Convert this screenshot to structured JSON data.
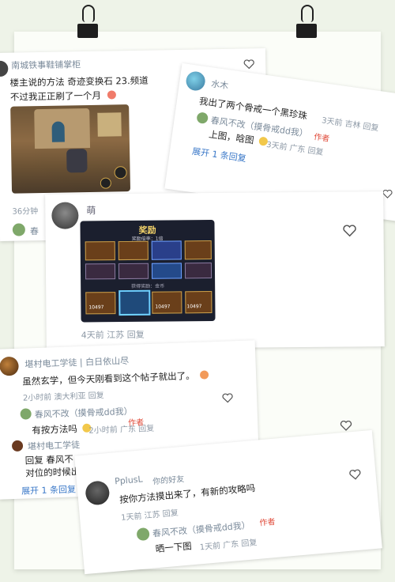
{
  "comment1": {
    "username": "南城铁事鞋铺掌柜",
    "line1": "楼主说的方法 奇迹变换石 23.频道",
    "line2": "不过我正正刷了一个月",
    "meta": "36分钟",
    "reply_name_partial": "春",
    "reply_partial2": "历"
  },
  "comment2": {
    "username": "水木",
    "text": "我出了两个骨戒一个黑珍珠",
    "meta": "3天前 吉林 回复",
    "reply_user": "春风不改（摸骨戒dd我）",
    "author_tag": "作者",
    "reply_text": "上图，晗图",
    "reply_meta": "3天前 广东 回复",
    "expand": "展开 1 条回复"
  },
  "comment3": {
    "username": "萌",
    "shot_title": "奖励",
    "shot_sub": "奖励倍率：1倍",
    "shot_foot": "获得奖励：金币",
    "cost_values": [
      "10497",
      "10497",
      "10497"
    ],
    "meta": "4天前 江苏 回复"
  },
  "comment4": {
    "username": "堪村电工学徒 | 白日依山尽",
    "text": "虽然玄学，但今天刚看到这个帖子就出了。",
    "meta": "2小时前 澳大利亚 回复",
    "reply_user": "春风不改（摸骨戒dd我）",
    "author_tag": "作者",
    "reply_text": "有按方法吗",
    "reply_meta": "2小时前 广东 回复",
    "reply2_user": "堪村电工学徒",
    "reply2_line1": "回复 春风不",
    "reply2_line2": "对位的时候出",
    "expand": "展开 1 条回复"
  },
  "comment5": {
    "username": "PplusL",
    "friend_tag": "你的好友",
    "text": "按你方法摸出来了，有新的攻略吗",
    "meta": "1天前 江苏 回复",
    "reply_user": "春风不改（摸骨戒dd我）",
    "author_tag": "作者",
    "reply_text": "晒一下图",
    "reply_meta": "1天前 广东 回复"
  },
  "colors": {
    "author_red": "#e04b3a",
    "link_blue": "#3a78c8",
    "meta_gray": "#8d99a6",
    "board_bg": "#fbfdf8"
  }
}
